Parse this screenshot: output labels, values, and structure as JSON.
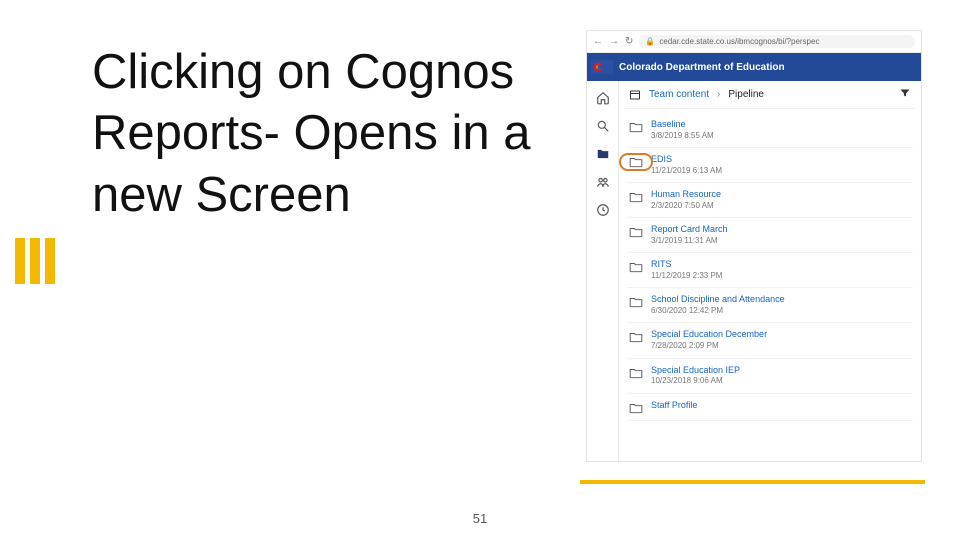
{
  "title": "Clicking on Cognos Reports-  Opens in a new Screen",
  "page_number": "51",
  "browser": {
    "url": "cedar.cde.state.co.us/ibmcognos/bi/?perspec",
    "banner_title": "Colorado Department of Education",
    "breadcrumb": {
      "root": "Team content",
      "current": "Pipeline"
    },
    "highlighted_index": 1,
    "folders": [
      {
        "name": "Baseline",
        "date": "3/8/2019 8:55 AM"
      },
      {
        "name": "EDIS",
        "date": "11/21/2019 6:13 AM"
      },
      {
        "name": "Human Resource",
        "date": "2/3/2020 7:50 AM"
      },
      {
        "name": "Report Card March",
        "date": "3/1/2019 11:31 AM"
      },
      {
        "name": "RITS",
        "date": "11/12/2019 2:33 PM"
      },
      {
        "name": "School Discipline and Attendance",
        "date": "6/30/2020 12:42 PM"
      },
      {
        "name": "Special Education December",
        "date": "7/28/2020 2:09 PM"
      },
      {
        "name": "Special Education IEP",
        "date": "10/23/2018 9:06 AM"
      },
      {
        "name": "Staff Profile",
        "date": ""
      }
    ]
  }
}
